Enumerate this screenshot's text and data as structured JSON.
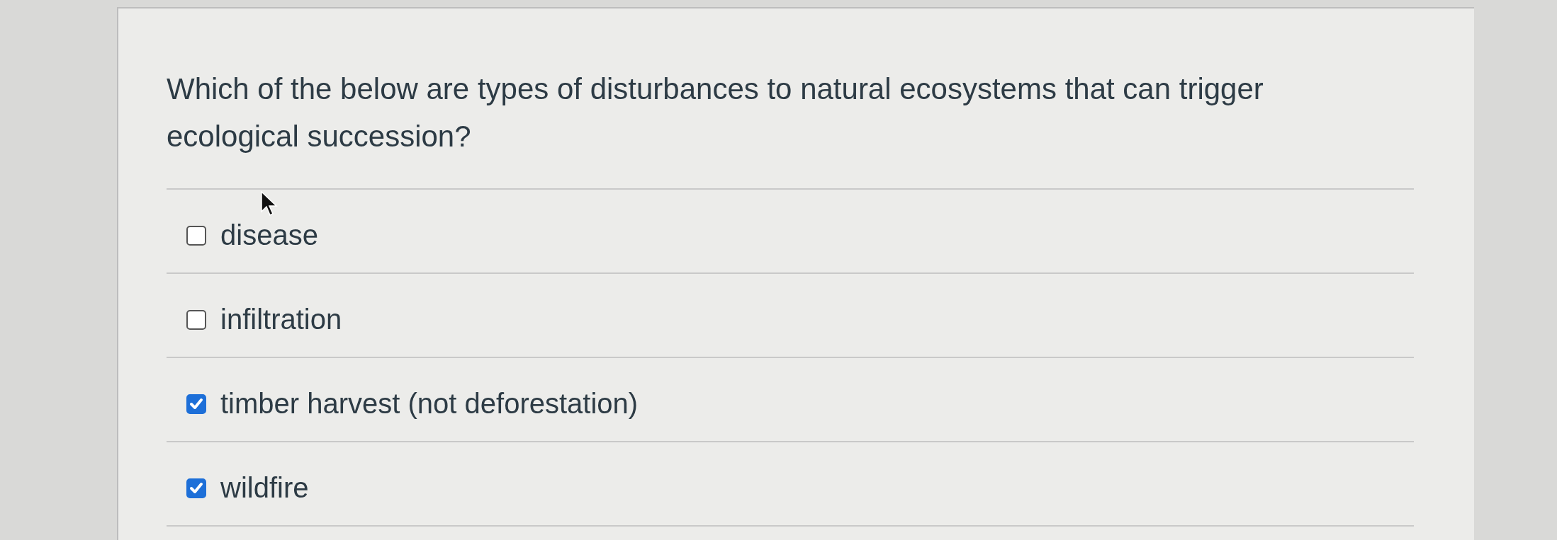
{
  "question": {
    "text": "Which of the below are types of disturbances to natural ecosystems that can trigger ecological succession?"
  },
  "options": [
    {
      "label": "disease",
      "checked": false
    },
    {
      "label": "infiltration",
      "checked": false
    },
    {
      "label": "timber harvest (not deforestation)",
      "checked": true
    },
    {
      "label": "wildfire",
      "checked": true
    }
  ]
}
